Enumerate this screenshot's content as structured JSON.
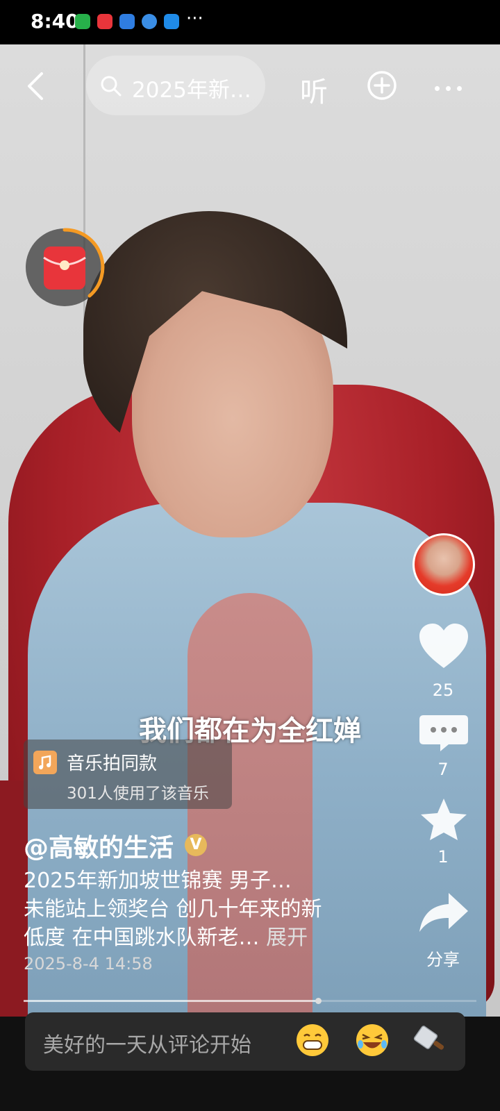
{
  "status_bar": {
    "time": "8:40",
    "more": "···"
  },
  "nav": {
    "search_query": "2025年新…",
    "listen_label": "听"
  },
  "video": {
    "subtitle": "我们都在为全红婵"
  },
  "music": {
    "title": "音乐拍同款",
    "usage": "301人使用了该音乐"
  },
  "caption": {
    "author": "@高敏的生活",
    "verified_badge": "V",
    "lines": [
      "2025年新加坡世锦赛 男子…",
      "未能站上领奖台 创几十年来的新",
      "低度 在中国跳水队新老… "
    ],
    "expand": "展开",
    "date": "2025-8-4 14:58"
  },
  "actions": {
    "likes": "25",
    "comments": "7",
    "favorites": "1",
    "share": "分享"
  },
  "playback": {
    "progress": 0.65
  },
  "comment_bar": {
    "placeholder": "美好的一天从评论开始"
  },
  "colors": {
    "packet_red": "#e8353b",
    "ring_orange": "#f59a23",
    "badge_gold": "#e7b95b"
  },
  "icons": [
    "back-icon",
    "search-icon",
    "plus-circle-icon",
    "more-icon",
    "red-packet-icon",
    "music-icon",
    "heart-icon",
    "comment-icon",
    "star-icon",
    "share-icon",
    "grin-emoji-icon",
    "laugh-emoji-icon",
    "cleaver-icon"
  ]
}
